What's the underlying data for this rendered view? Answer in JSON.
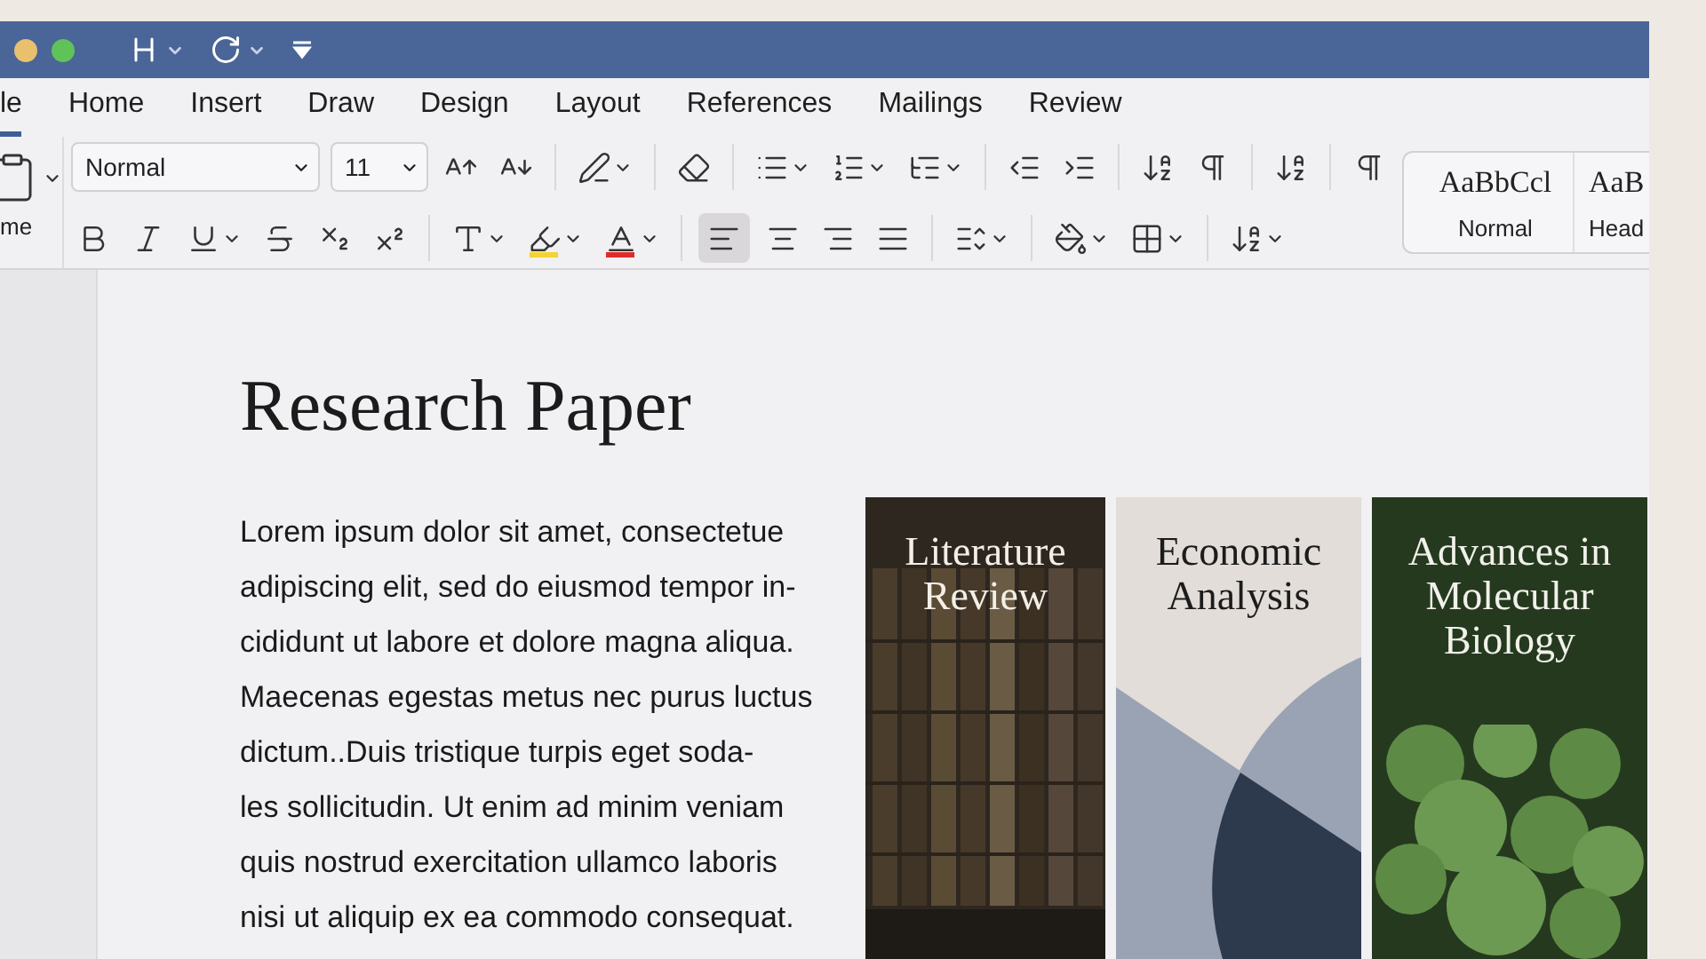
{
  "titlebar": {
    "icons": [
      {
        "kind": "heading",
        "dropdown": true
      },
      {
        "kind": "redo",
        "dropdown": true
      },
      {
        "kind": "customize"
      }
    ]
  },
  "tabs": [
    {
      "label": "le",
      "selected": true
    },
    {
      "label": "Home",
      "selected": false
    },
    {
      "label": "Insert",
      "selected": false
    },
    {
      "label": "Draw",
      "selected": false
    },
    {
      "label": "Design",
      "selected": false
    },
    {
      "label": "Layout",
      "selected": false
    },
    {
      "label": "References",
      "selected": false
    },
    {
      "label": "Mailings",
      "selected": false
    },
    {
      "label": "Review",
      "selected": false
    }
  ],
  "ribbon": {
    "paste": {
      "label": "me"
    },
    "font": {
      "value": "Normal"
    },
    "size": {
      "value": "11"
    },
    "row1": [
      {
        "kind": "grow"
      },
      {
        "kind": "shrink"
      },
      {
        "kind": "sep"
      },
      {
        "kind": "styles",
        "dropdown": true
      },
      {
        "kind": "sep"
      },
      {
        "kind": "clear"
      },
      {
        "kind": "sep"
      },
      {
        "kind": "bullets",
        "dropdown": true
      },
      {
        "kind": "numbering",
        "dropdown": true
      },
      {
        "kind": "multilevel",
        "dropdown": true
      },
      {
        "kind": "sep"
      },
      {
        "kind": "outdent"
      },
      {
        "kind": "indent"
      },
      {
        "kind": "sep"
      },
      {
        "kind": "sort"
      },
      {
        "kind": "pilcrow"
      },
      {
        "kind": "sep"
      },
      {
        "kind": "sort"
      },
      {
        "kind": "sep"
      },
      {
        "kind": "pilcrow"
      }
    ],
    "row2": [
      {
        "kind": "bold"
      },
      {
        "kind": "italic"
      },
      {
        "kind": "underline",
        "dropdown": true
      },
      {
        "kind": "strike"
      },
      {
        "kind": "sub"
      },
      {
        "kind": "sup"
      },
      {
        "kind": "sep"
      },
      {
        "kind": "effects",
        "dropdown": true
      },
      {
        "kind": "highlight",
        "dropdown": true,
        "color": "#f2d530"
      },
      {
        "kind": "fontcolor",
        "dropdown": true,
        "color": "#e02a2a"
      },
      {
        "kind": "sep"
      },
      {
        "kind": "alignleft",
        "selected": true
      },
      {
        "kind": "aligncenter",
        "selected": false
      },
      {
        "kind": "alignright",
        "selected": false
      },
      {
        "kind": "justify",
        "selected": false
      },
      {
        "kind": "sep"
      },
      {
        "kind": "spacing",
        "dropdown": true
      },
      {
        "kind": "sep"
      },
      {
        "kind": "shading",
        "dropdown": true
      },
      {
        "kind": "borders",
        "dropdown": true
      },
      {
        "kind": "sep"
      },
      {
        "kind": "sort",
        "dropdown": true
      }
    ],
    "styles": [
      {
        "sample": "AaBbCcl",
        "label": "Normal"
      },
      {
        "sample": "AaB",
        "label": "Head"
      }
    ]
  },
  "document": {
    "title": "Research Paper",
    "paragraph": [
      "Lorem ipsum dolor sit amet, consectetue",
      "adipiscing elit, sed do eiusmod tempor in-",
      "cididunt ut labore et dolore magna aliqua.",
      "Maecenas egestas metus nec purus luctus",
      "dictum..Duis tristique turpis eget soda-",
      "les sollicitudin. Ut enim ad minim veniam",
      "quis nostrud exercitation ullamco laboris",
      "nisi ut aliquip ex ea commodo consequat."
    ],
    "covers": [
      {
        "kind": "books",
        "title": "Literature Review"
      },
      {
        "kind": "shapes",
        "title": "Economic Analysis"
      },
      {
        "kind": "cells",
        "title": "Advances in Molecular Biology"
      }
    ]
  }
}
